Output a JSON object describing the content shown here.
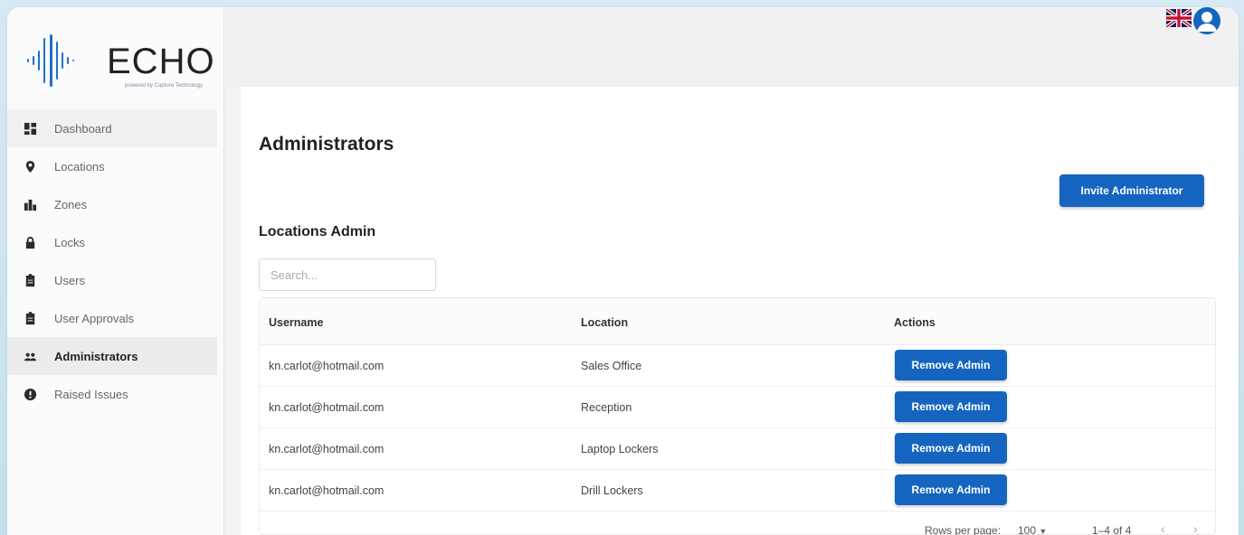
{
  "brand": {
    "name": "ECHO",
    "tagline": "powered by Capture Technology"
  },
  "sidebar": {
    "items": [
      {
        "label": "Dashboard",
        "icon": "dashboard-icon"
      },
      {
        "label": "Locations",
        "icon": "location-pin-icon"
      },
      {
        "label": "Zones",
        "icon": "buildings-icon"
      },
      {
        "label": "Locks",
        "icon": "lock-icon"
      },
      {
        "label": "Users",
        "icon": "clipboard-icon"
      },
      {
        "label": "User Approvals",
        "icon": "clipboard-icon"
      },
      {
        "label": "Administrators",
        "icon": "people-icon"
      },
      {
        "label": "Raised Issues",
        "icon": "alert-icon"
      }
    ],
    "active": "Administrators"
  },
  "header": {
    "language_icon": "uk-flag-icon",
    "account_icon": "user-avatar-icon"
  },
  "main": {
    "title": "Administrators",
    "invite_label": "Invite Administrator",
    "section_title": "Locations Admin",
    "search": {
      "placeholder": "Search...",
      "value": ""
    },
    "table": {
      "columns": [
        "Username",
        "Location",
        "Actions"
      ],
      "rows": [
        {
          "username": "kn.carlot@hotmail.com",
          "location": "Sales Office",
          "action": "Remove Admin"
        },
        {
          "username": "kn.carlot@hotmail.com",
          "location": "Reception",
          "action": "Remove Admin"
        },
        {
          "username": "kn.carlot@hotmail.com",
          "location": "Laptop Lockers",
          "action": "Remove Admin"
        },
        {
          "username": "kn.carlot@hotmail.com",
          "location": "Drill Lockers",
          "action": "Remove Admin"
        }
      ]
    },
    "pagination": {
      "rows_per_page_label": "Rows per page:",
      "rows_per_page": "100",
      "range": "1–4 of 4"
    }
  },
  "colors": {
    "primary": "#1565c0",
    "sidebar_active": "#ececec"
  }
}
